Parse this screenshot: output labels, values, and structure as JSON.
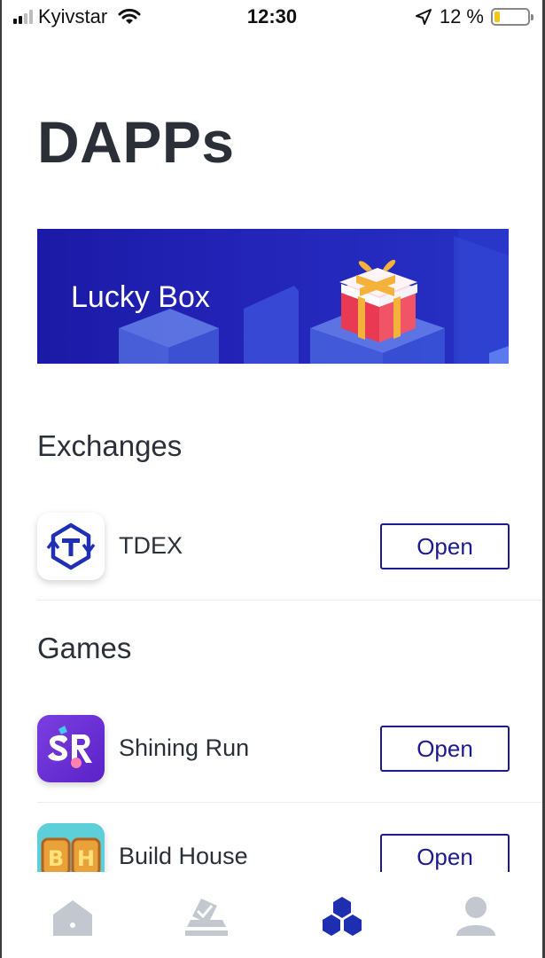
{
  "status_bar": {
    "carrier": "Kyivstar",
    "time": "12:30",
    "battery_percent": "12 %",
    "battery_level": 0.12,
    "signal_bars_active": 2,
    "icons": [
      "signal-icon",
      "wifi-icon",
      "location-arrow-icon",
      "battery-icon"
    ]
  },
  "page": {
    "title": "DAPPs"
  },
  "banner": {
    "label": "Lucky Box",
    "background": "#1b1aa6",
    "icon": "gift-box-icon"
  },
  "sections": [
    {
      "title": "Exchanges",
      "items": [
        {
          "name": "TDEX",
          "button": "Open",
          "icon": "tdex-logo-icon"
        }
      ]
    },
    {
      "title": "Games",
      "items": [
        {
          "name": "Shining Run",
          "button": "Open",
          "icon": "shining-run-logo-icon"
        },
        {
          "name": "Build House",
          "button": "Open",
          "icon": "build-house-logo-icon"
        }
      ]
    }
  ],
  "tab_bar": {
    "tabs": [
      {
        "icon": "home-icon",
        "active": false
      },
      {
        "icon": "vote-icon",
        "active": false
      },
      {
        "icon": "dapps-icon",
        "active": true
      },
      {
        "icon": "profile-icon",
        "active": false
      }
    ],
    "active_color": "#1d2fb0",
    "inactive_color": "#c3c7cf"
  },
  "colors": {
    "accent": "#1c1a8f",
    "text": "#2b2f38"
  }
}
